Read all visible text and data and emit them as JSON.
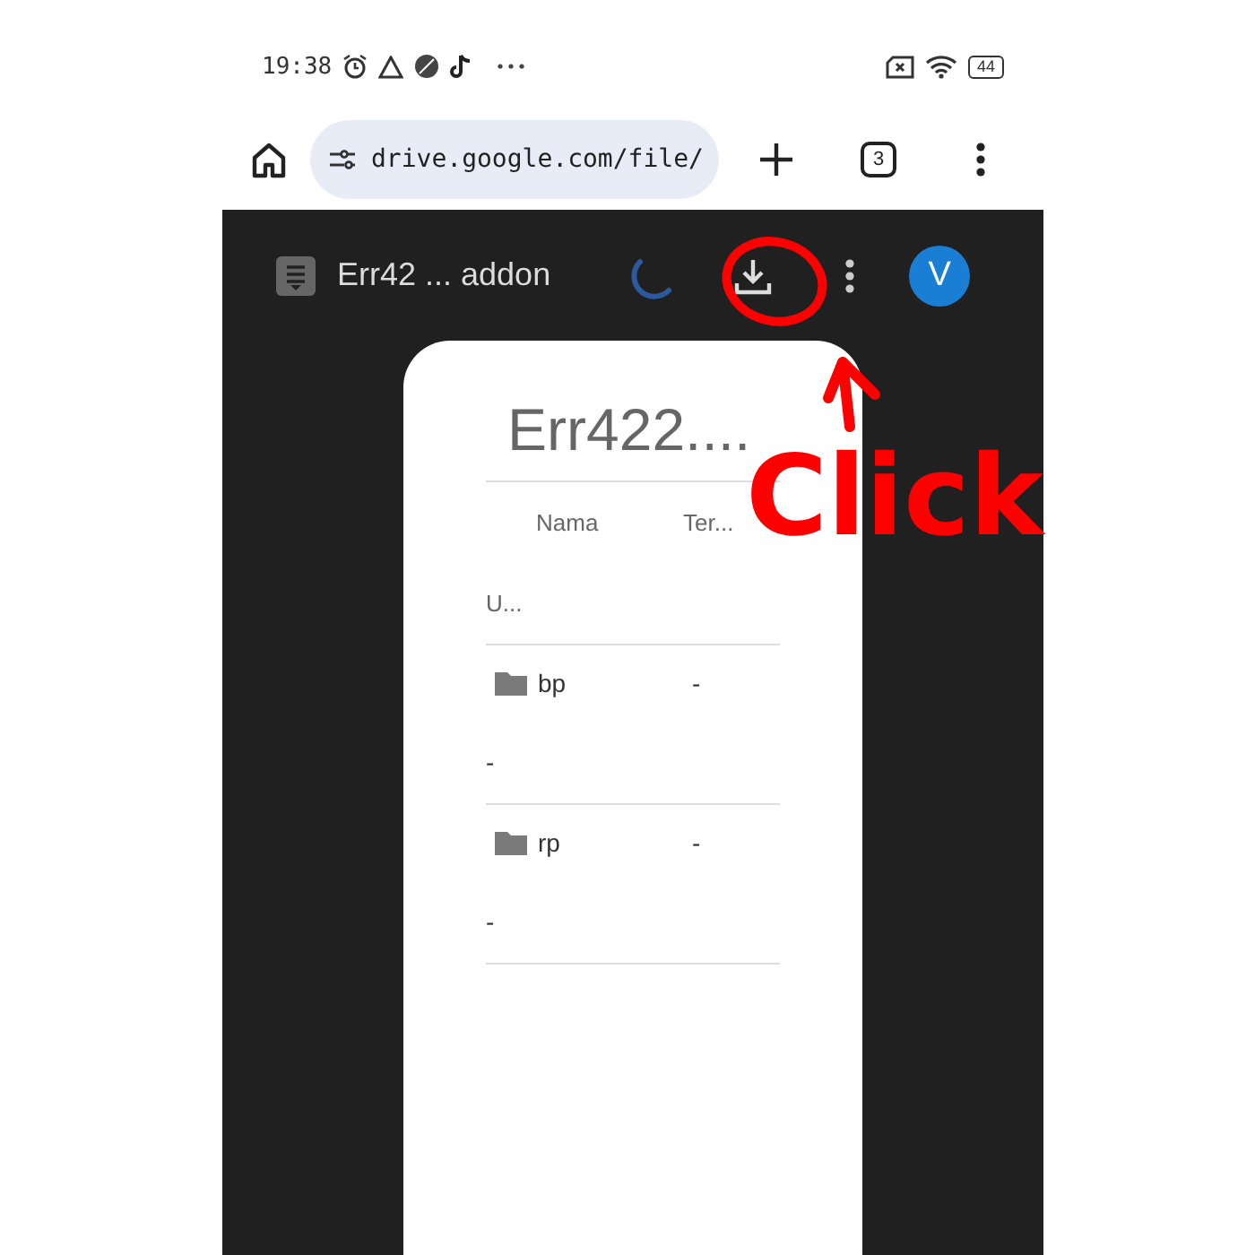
{
  "status_bar": {
    "time": "19:38",
    "battery": "44"
  },
  "browser": {
    "url": "drive.google.com/file/",
    "tab_count": "3"
  },
  "viewer": {
    "file_title": "Err42 ... addon",
    "avatar": "V"
  },
  "document": {
    "title": "Err422....",
    "columns": [
      "Nama",
      "Ter..."
    ],
    "rows": [
      {
        "kind": "plain",
        "label": "U..."
      },
      {
        "kind": "folder",
        "name": "bp",
        "column_2": "-",
        "detail": "-"
      },
      {
        "kind": "folder",
        "name": "rp",
        "column_2": "-",
        "detail": "-"
      }
    ]
  },
  "annotation": {
    "text": "Click"
  }
}
